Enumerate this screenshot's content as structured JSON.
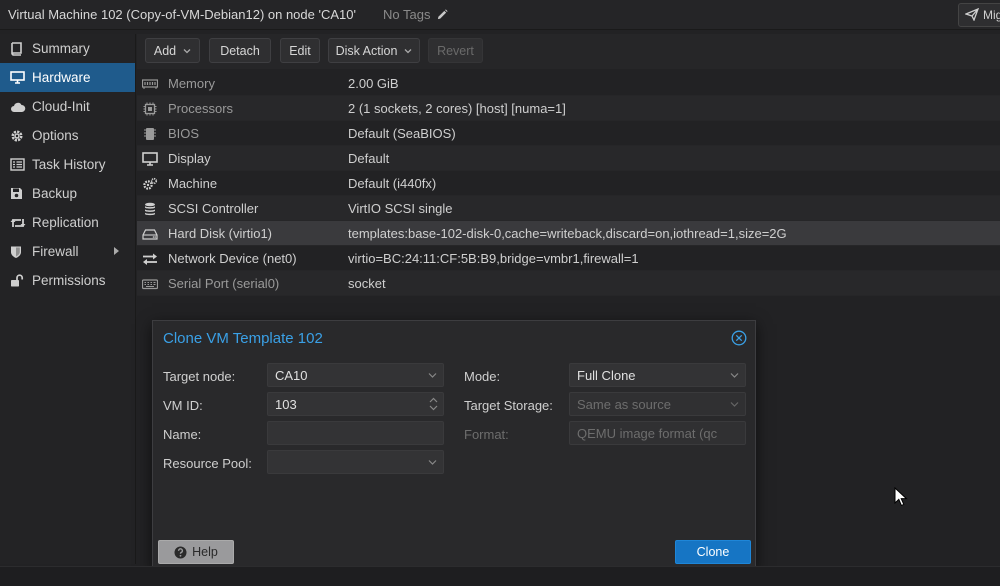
{
  "header": {
    "title": "Virtual Machine 102 (Copy-of-VM-Debian12) on node 'CA10'",
    "tags": "No Tags",
    "migrate_label": "Mig"
  },
  "sidebar": {
    "items": [
      {
        "label": "Summary",
        "icon": "book-icon"
      },
      {
        "label": "Hardware",
        "icon": "monitor-icon",
        "active": true
      },
      {
        "label": "Cloud-Init",
        "icon": "cloud-icon"
      },
      {
        "label": "Options",
        "icon": "gear-icon"
      },
      {
        "label": "Task History",
        "icon": "list-icon"
      },
      {
        "label": "Backup",
        "icon": "floppy-icon"
      },
      {
        "label": "Replication",
        "icon": "retweet-icon"
      },
      {
        "label": "Firewall",
        "icon": "shield-icon"
      },
      {
        "label": "Permissions",
        "icon": "unlock-icon"
      }
    ]
  },
  "toolbar": {
    "add": "Add",
    "detach": "Detach",
    "edit": "Edit",
    "disk_action": "Disk Action",
    "revert": "Revert"
  },
  "hardware": [
    {
      "name": "Memory",
      "value": "2.00 GiB",
      "icon": "memory-icon"
    },
    {
      "name": "Processors",
      "value": "2 (1 sockets, 2 cores) [host] [numa=1]",
      "icon": "cpu-icon"
    },
    {
      "name": "BIOS",
      "value": "Default (SeaBIOS)",
      "icon": "chip-icon"
    },
    {
      "name": "Display",
      "value": "Default",
      "icon": "desktop-icon"
    },
    {
      "name": "Machine",
      "value": "Default (i440fx)",
      "icon": "cogs-icon"
    },
    {
      "name": "SCSI Controller",
      "value": "VirtIO SCSI single",
      "icon": "database-icon"
    },
    {
      "name": "Hard Disk (virtio1)",
      "value": "templates:base-102-disk-0,cache=writeback,discard=on,iothread=1,size=2G",
      "icon": "hdd-icon"
    },
    {
      "name": "Network Device (net0)",
      "value": "virtio=BC:24:11:CF:5B:B9,bridge=vmbr1,firewall=1",
      "icon": "exchange-icon"
    },
    {
      "name": "Serial Port (serial0)",
      "value": "socket",
      "icon": "keyboard-icon"
    }
  ],
  "dialog": {
    "title": "Clone VM Template 102",
    "target_node_label": "Target node:",
    "target_node_value": "CA10",
    "vmid_label": "VM ID:",
    "vmid_value": "103",
    "name_label": "Name:",
    "name_value": "",
    "pool_label": "Resource Pool:",
    "pool_value": "",
    "mode_label": "Mode:",
    "mode_value": "Full Clone",
    "storage_label": "Target Storage:",
    "storage_value": "Same as source",
    "format_label": "Format:",
    "format_value": "QEMU image format (qc",
    "help": "Help",
    "clone": "Clone"
  },
  "colors": {
    "accent": "#1675c4",
    "active_nav": "#1f5b8c",
    "dialog_title": "#3aa0e6"
  }
}
